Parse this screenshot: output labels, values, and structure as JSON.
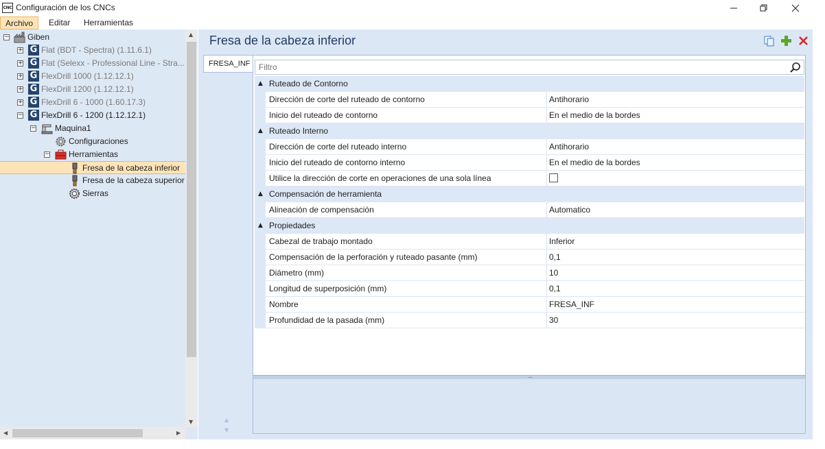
{
  "window": {
    "app_icon_text": "CNC",
    "title": "Configuración de los CNCs"
  },
  "menu": {
    "items": [
      "Archivo",
      "Editar",
      "Herramientas"
    ],
    "active_index": 0
  },
  "tree": {
    "items": [
      {
        "label": "Giben",
        "level": 0,
        "expander": "minus",
        "icon": "factory-icon",
        "gray": false
      },
      {
        "label": "Flat (BDT - Spectra) (1.11.6.1)",
        "level": 1,
        "expander": "plus",
        "icon": "machine-logo-icon",
        "gray": true
      },
      {
        "label": "Flat (Selexx - Professional Line - Stra...",
        "level": 1,
        "expander": "plus",
        "icon": "machine-logo-icon",
        "gray": true
      },
      {
        "label": "FlexDrill 1000 (1.12.12.1)",
        "level": 1,
        "expander": "plus",
        "icon": "machine-logo-icon",
        "gray": true
      },
      {
        "label": "FlexDrill 1200 (1.12.12.1)",
        "level": 1,
        "expander": "plus",
        "icon": "machine-logo-icon",
        "gray": true
      },
      {
        "label": "FlexDrill 6 - 1000 (1.60.17.3)",
        "level": 1,
        "expander": "plus",
        "icon": "machine-logo-icon",
        "gray": true
      },
      {
        "label": "FlexDrill 6 - 1200 (1.12.12.1)",
        "level": 1,
        "expander": "minus",
        "icon": "machine-logo-icon",
        "gray": false
      },
      {
        "label": "Maquina1",
        "level": 2,
        "expander": "minus",
        "icon": "machine-icon",
        "gray": false
      },
      {
        "label": "Configuraciones",
        "level": 3,
        "expander": "none",
        "icon": "settings-gear-icon",
        "gray": false
      },
      {
        "label": "Herramientas",
        "level": 3,
        "expander": "minus",
        "icon": "toolbox-icon",
        "gray": false
      },
      {
        "label": "Fresa de la cabeza inferior",
        "level": 4,
        "expander": "none",
        "icon": "router-bit-icon",
        "gray": false,
        "selected": true
      },
      {
        "label": "Fresa de la cabeza superior",
        "level": 4,
        "expander": "none",
        "icon": "router-bit-icon",
        "gray": false
      },
      {
        "label": "Sierras",
        "level": 4,
        "expander": "none",
        "icon": "saw-gear-icon",
        "gray": false
      }
    ]
  },
  "main": {
    "title": "Fresa de la cabeza inferior",
    "tab_label": "FRESA_INF",
    "filter_placeholder": "Filtro",
    "categories": [
      {
        "label": "Ruteado de Contorno",
        "properties": [
          {
            "name": "Dirección de corte del ruteado de contorno",
            "value": "Antihorario"
          },
          {
            "name": "Inicio del ruteado de contorno",
            "value": "En el medio de la bordes"
          }
        ]
      },
      {
        "label": "Ruteado Interno",
        "properties": [
          {
            "name": "Dirección de corte del ruteado interno",
            "value": "Antihorario"
          },
          {
            "name": "Inicio del ruteado de contorno interno",
            "value": "En el medio de la bordes"
          },
          {
            "name": "Utilice la dirección de corte en operaciones de una sola línea",
            "value": "",
            "checkbox": true,
            "checked": false
          }
        ]
      },
      {
        "label": "Compensación de herramienta",
        "properties": [
          {
            "name": "Alineación de compensación",
            "value": "Automatico"
          }
        ]
      },
      {
        "label": "Propiedades",
        "properties": [
          {
            "name": "Cabezal de trabajo montado",
            "value": "Inferior"
          },
          {
            "name": "Compensación de la perforación y ruteado pasante (mm)",
            "value": "0,1"
          },
          {
            "name": "Diámetro (mm)",
            "value": "10"
          },
          {
            "name": "Longitud de superposición (mm)",
            "value": "0,1"
          },
          {
            "name": "Nombre",
            "value": "FRESA_INF"
          },
          {
            "name": "Profundidad de la pasada (mm)",
            "value": "30"
          }
        ]
      }
    ]
  },
  "colors": {
    "selection": "#fde4b8",
    "panel": "#dce7f6",
    "title_text": "#1f3a5f",
    "add_icon": "#5aa82a",
    "delete_icon": "#e02020"
  }
}
